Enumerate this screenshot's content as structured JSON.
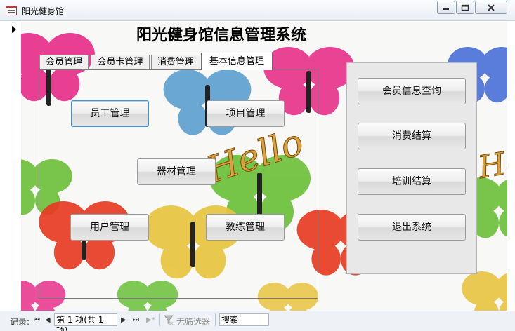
{
  "window": {
    "title": "阳光健身馆",
    "minimize_icon": "minimize-icon",
    "maximize_icon": "maximize-icon",
    "close_icon": "close-icon"
  },
  "form": {
    "title": "阳光健身馆信息管理系统",
    "background_text": "Hello"
  },
  "tabs": [
    {
      "label": "会员管理",
      "selected": false
    },
    {
      "label": "会员卡管理",
      "selected": false
    },
    {
      "label": "消费管理",
      "selected": false
    },
    {
      "label": "基本信息管理",
      "selected": true
    }
  ],
  "basic_info_buttons": {
    "staff": "员工管理",
    "project": "项目管理",
    "equipment": "器材管理",
    "user": "用户管理",
    "coach": "教练管理"
  },
  "side_buttons": {
    "member_query": "会员信息查询",
    "consume_settle": "消费结算",
    "training_settle": "培训结算",
    "exit": "退出系统"
  },
  "navigation": {
    "label": "记录:",
    "first": "⏮",
    "prev": "◀",
    "position": "第 1 项(共 1 项)",
    "next": "▶",
    "last": "⏭",
    "new": "▶*",
    "filter_label": "无筛选器",
    "search_placeholder": "搜索"
  },
  "colors": {
    "accent_focus": "#3c96d8",
    "butterfly_pink": "#e8308a",
    "butterfly_blue": "#5c9fd0",
    "butterfly_green": "#6cc03a",
    "butterfly_yellow": "#e8c440",
    "butterfly_red": "#e83820"
  }
}
